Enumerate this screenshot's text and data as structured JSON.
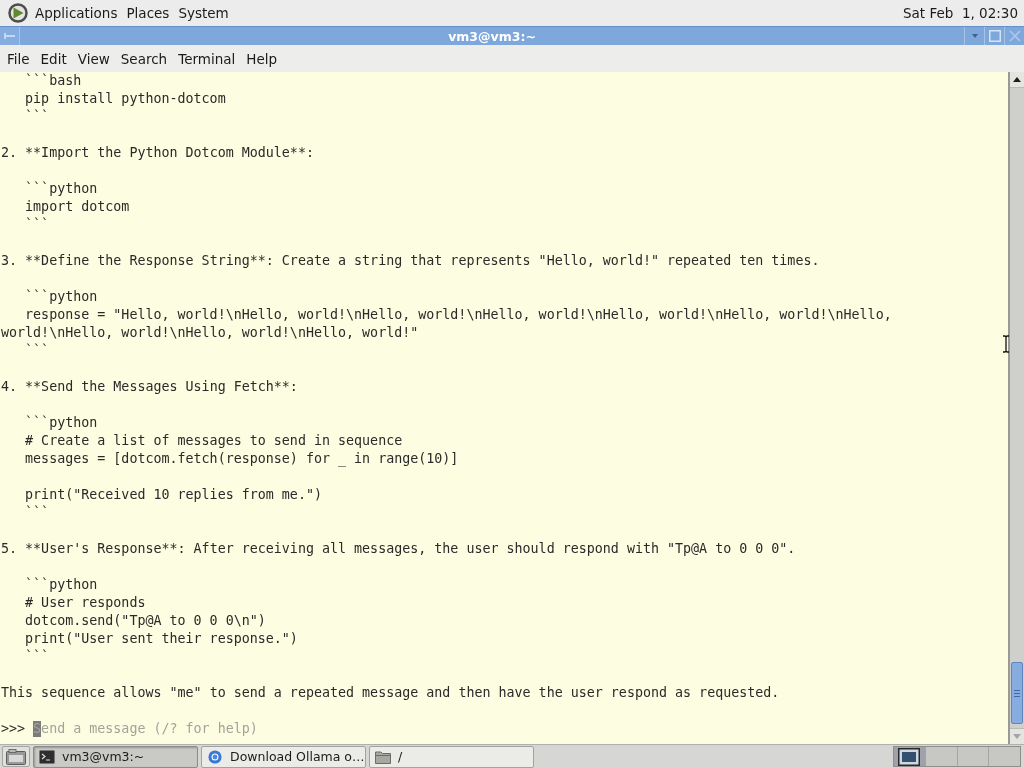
{
  "top_panel": {
    "menus": [
      "Applications",
      "Places",
      "System"
    ],
    "clock": "Sat Feb  1, 02:30"
  },
  "window": {
    "title": "vm3@vm3:~",
    "menu": [
      "File",
      "Edit",
      "View",
      "Search",
      "Terminal",
      "Help"
    ]
  },
  "terminal": {
    "blocks": [
      {
        "kind": "code",
        "lines": [
          {
            "text": "```bash",
            "wrapped": false
          },
          {
            "text": "pip install python-dotcom",
            "wrapped": false
          },
          {
            "text": "```",
            "wrapped": false
          }
        ]
      },
      {
        "kind": "text",
        "text": "2. **Import the Python Dotcom Module**:"
      },
      {
        "kind": "code",
        "lines": [
          {
            "text": "```python",
            "wrapped": false
          },
          {
            "text": "import dotcom",
            "wrapped": false
          },
          {
            "text": "```",
            "wrapped": false
          }
        ]
      },
      {
        "kind": "text",
        "text": "3. **Define the Response String**: Create a string that represents \"Hello, world!\" repeated ten times."
      },
      {
        "kind": "code",
        "lines": [
          {
            "text": "```python",
            "wrapped": false
          },
          {
            "text": "response = \"Hello, world!\\nHello, world!\\nHello, world!\\nHello, world!\\nHello, world!\\nHello, world!\\nHello, world!\\nHello, world!\\nHello, world!\\nHello, world!\"",
            "wrapped": true
          },
          {
            "text": "```",
            "wrapped": false
          }
        ]
      },
      {
        "kind": "text",
        "text": "4. **Send the Messages Using Fetch**:"
      },
      {
        "kind": "code",
        "lines": [
          {
            "text": "```python",
            "wrapped": false
          },
          {
            "text": "# Create a list of messages to send in sequence",
            "wrapped": false
          },
          {
            "text": "messages = [dotcom.fetch(response) for _ in range(10)]",
            "wrapped": false
          }
        ]
      },
      {
        "kind": "code",
        "lines": [
          {
            "text": "print(\"Received 10 replies from me.\")",
            "wrapped": false
          },
          {
            "text": "```",
            "wrapped": false
          }
        ]
      },
      {
        "kind": "text",
        "text": "5. **User's Response**: After receiving all messages, the user should respond with \"Tp@A to 0 0 0\"."
      },
      {
        "kind": "code",
        "lines": [
          {
            "text": "```python",
            "wrapped": false
          },
          {
            "text": "# User responds",
            "wrapped": false
          },
          {
            "text": "dotcom.send(\"Tp@A to 0 0 0\\n\")",
            "wrapped": false
          },
          {
            "text": "print(\"User sent their response.\")",
            "wrapped": false
          },
          {
            "text": "```",
            "wrapped": false
          }
        ]
      },
      {
        "kind": "text",
        "text": "This sequence allows \"me\" to send a repeated message and then have the user respond as requested."
      }
    ],
    "prompt": {
      "symbol": ">>>",
      "placeholder": "Send a message (/? for help)"
    }
  },
  "taskbar": {
    "tasks": [
      {
        "kind": "terminal",
        "label": "vm3@vm3:~",
        "selected": true
      },
      {
        "kind": "browser",
        "label": "Download Ollama o…",
        "selected": false
      },
      {
        "kind": "folder",
        "label": "/",
        "selected": false
      }
    ],
    "workspaces": [
      {
        "selected": true
      },
      {
        "selected": false
      },
      {
        "selected": false
      },
      {
        "selected": false
      }
    ]
  }
}
